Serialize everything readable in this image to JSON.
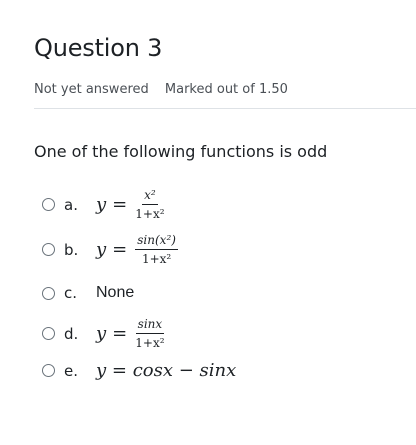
{
  "question": {
    "title": "Question 3",
    "status": "Not yet answered",
    "marks": "Marked out of 1.50",
    "prompt": "One of the following functions is  odd"
  },
  "options": [
    {
      "letter": "a.",
      "lhs": "y",
      "num": "x²",
      "den": "1+x²"
    },
    {
      "letter": "b.",
      "lhs": "y",
      "num": "sin(x²)",
      "den": "1+x²"
    },
    {
      "letter": "c.",
      "text": "None"
    },
    {
      "letter": "d.",
      "lhs": "y",
      "num": "sinx",
      "den": "1+x²"
    },
    {
      "letter": "e.",
      "expr": "y = cosx − sinx"
    }
  ]
}
